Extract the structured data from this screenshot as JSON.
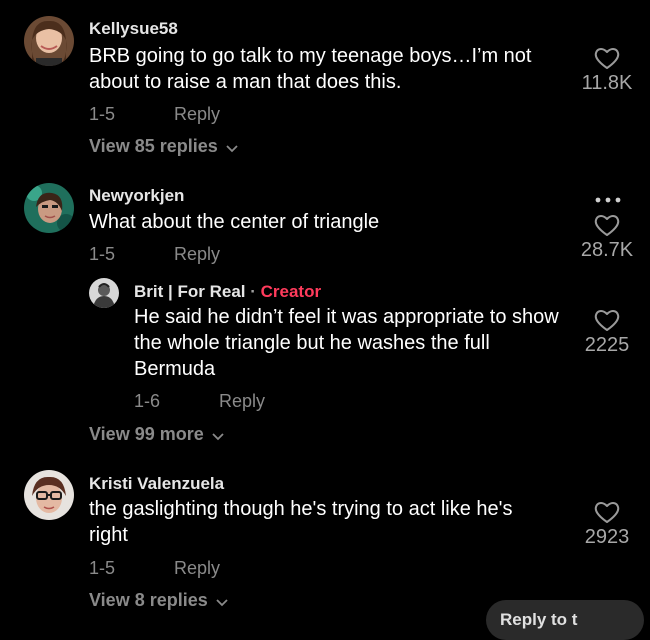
{
  "colors": {
    "background": "#000000",
    "creator_accent": "#ff3b5c",
    "muted_text": "#8a8a8a"
  },
  "comments": [
    {
      "username": "Kellysue58",
      "text": "BRB going to go talk to my teenage boys…I’m not about to raise a man that does this.",
      "date": "1-5",
      "reply_label": "Reply",
      "likes": "11.8K",
      "view_replies": "View 85 replies"
    },
    {
      "username": "Newyorkjen",
      "text": "What about the center of triangle",
      "date": "1-5",
      "reply_label": "Reply",
      "likes": "28.7K",
      "more_icon": "more-options-icon",
      "replies": [
        {
          "username": "Brit | For Real",
          "separator": " · ",
          "badge": "Creator",
          "text": "He said he didn’t feel it was appropriate to show the whole triangle but he washes the full Bermuda",
          "date": "1-6",
          "reply_label": "Reply",
          "likes": "2225"
        }
      ],
      "view_more": "View 99 more"
    },
    {
      "username": "Kristi Valenzuela",
      "text": "the gaslighting though he's trying to act like he's right",
      "date": "1-5",
      "reply_label": "Reply",
      "likes": "2923",
      "view_replies": "View 8 replies"
    }
  ],
  "footer_pill": {
    "label": "Reply to t"
  }
}
